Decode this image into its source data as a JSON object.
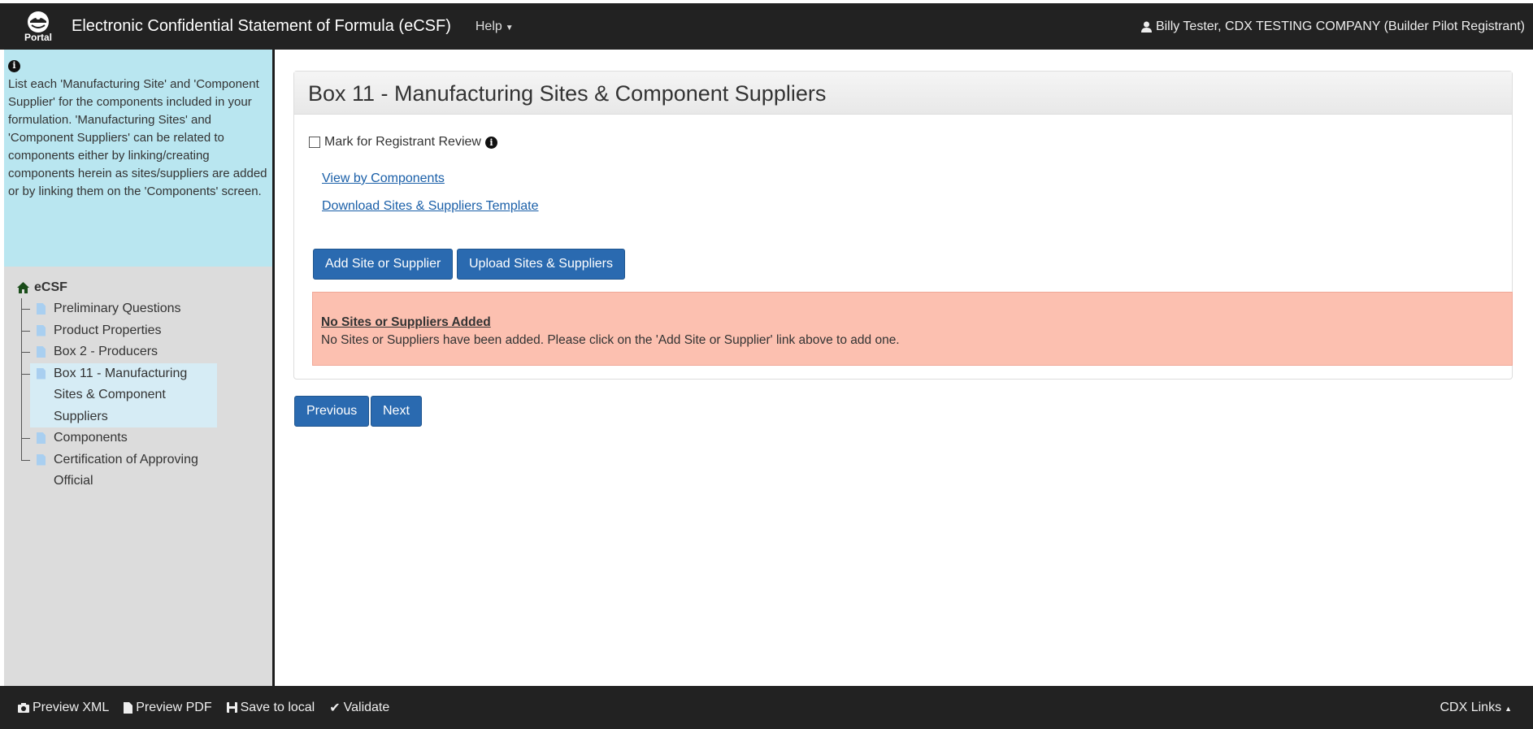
{
  "navbar": {
    "brand_label": "Portal",
    "title": "Electronic Confidential Statement of Formula (eCSF)",
    "help_label": "Help",
    "user": "Billy Tester, CDX TESTING COMPANY (Builder Pilot Registrant)"
  },
  "sidebar": {
    "info_text": "List each 'Manufacturing Site' and 'Component Supplier' for the components included in your formulation. 'Manufacturing Sites' and 'Component Suppliers' can be related to components either by linking/creating components herein as sites/suppliers are added or by linking them on the 'Components' screen.",
    "tree_root": "eCSF",
    "items": [
      {
        "label": "Preliminary Questions"
      },
      {
        "label": "Product Properties"
      },
      {
        "label": "Box 2 - Producers"
      },
      {
        "label": "Box 11 - Manufacturing Sites & Component Suppliers"
      },
      {
        "label": "Components"
      },
      {
        "label": "Certification of Approving Official"
      }
    ]
  },
  "main": {
    "heading": "Box 11 - Manufacturing Sites & Component Suppliers",
    "review_label": "Mark for Registrant Review",
    "link_components": "View by Components",
    "link_template": "Download Sites & Suppliers Template",
    "btn_add": "Add Site or Supplier",
    "btn_upload": "Upload Sites & Suppliers",
    "alert_title": "No Sites or Suppliers Added",
    "alert_text": "No Sites or Suppliers have been added. Please click on the 'Add Site or Supplier' link above to add one.",
    "btn_previous": "Previous",
    "btn_next": "Next"
  },
  "footer": {
    "preview_xml": "Preview XML",
    "preview_pdf": "Preview PDF",
    "save_local": "Save to local",
    "validate": "Validate",
    "cdx_links": "CDX Links"
  }
}
